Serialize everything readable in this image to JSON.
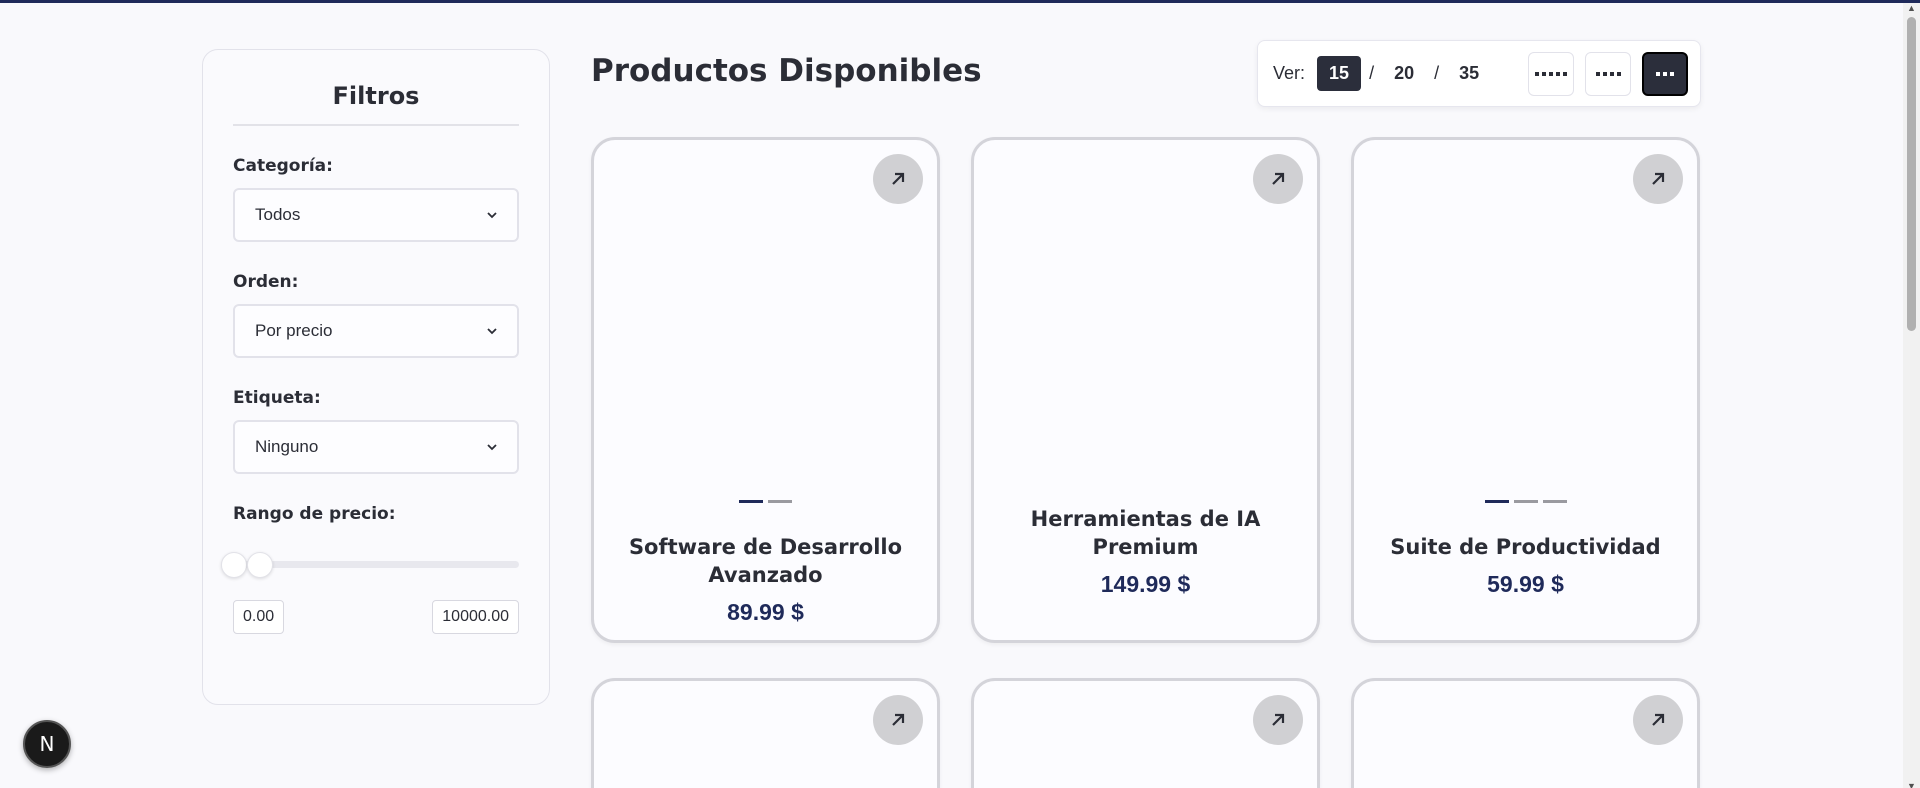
{
  "filters": {
    "title": "Filtros",
    "category": {
      "label": "Categoría:",
      "value": "Todos"
    },
    "order": {
      "label": "Orden:",
      "value": "Por precio"
    },
    "tag": {
      "label": "Etiqueta:",
      "value": "Ninguno"
    },
    "price_range": {
      "label": "Rango de precio:",
      "min": "0.00",
      "max": "10000.00"
    }
  },
  "main": {
    "title": "Productos Disponibles"
  },
  "view": {
    "label": "Ver:",
    "counts": [
      "15",
      "20",
      "35"
    ],
    "separators": [
      "/",
      "/"
    ],
    "active_count": "15",
    "grid_options": [
      "grid-5-icon",
      "grid-4-icon",
      "grid-3-icon"
    ],
    "active_grid": "grid-3-icon"
  },
  "products": [
    {
      "name": "Software de Desarrollo Avanzado",
      "price": "89.99 $",
      "images": 2
    },
    {
      "name": "Herramientas de IA Premium",
      "price": "149.99 $",
      "images": 0
    },
    {
      "name": "Suite de Productividad",
      "price": "59.99 $",
      "images": 3
    },
    {
      "name": "",
      "price": "",
      "images": 0
    },
    {
      "name": "",
      "price": "",
      "images": 0
    },
    {
      "name": "",
      "price": "",
      "images": 0
    }
  ],
  "badge": {
    "label": "N"
  },
  "colors": {
    "accent": "#1f2a5a",
    "dark": "#2b2e3b",
    "text": "#2b2d36"
  }
}
